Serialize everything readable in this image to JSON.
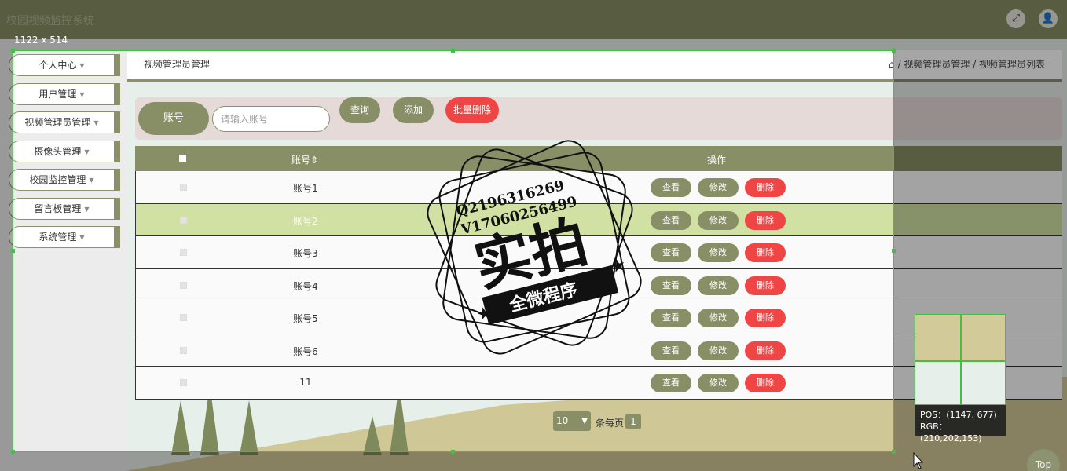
{
  "app": {
    "title": "校园视频监控系统"
  },
  "header": {
    "expand_icon": "⤢",
    "user_icon": "👤"
  },
  "sidebar": {
    "items": [
      {
        "label": "个人中心"
      },
      {
        "label": "用户管理"
      },
      {
        "label": "视频管理员管理"
      },
      {
        "label": "摄像头管理"
      },
      {
        "label": "校园监控管理"
      },
      {
        "label": "留言板管理"
      },
      {
        "label": "系统管理"
      }
    ]
  },
  "page": {
    "title": "视频管理员管理",
    "breadcrumb": "/ 视频管理员管理 / 视频管理员列表"
  },
  "search": {
    "label": "账号",
    "placeholder": "请输入账号",
    "query_label": "查询",
    "add_label": "添加",
    "batch_delete_label": "批量删除"
  },
  "table": {
    "headers": {
      "account": "账号",
      "sort_icon": "⇕",
      "ops": "操作"
    },
    "rows": [
      {
        "account": "账号1"
      },
      {
        "account": "账号2"
      },
      {
        "account": "账号3"
      },
      {
        "account": "账号4"
      },
      {
        "account": "账号5"
      },
      {
        "account": "账号6"
      },
      {
        "account": "11"
      }
    ],
    "actions": {
      "view": "查看",
      "edit": "修改",
      "delete": "删除"
    }
  },
  "pager": {
    "page_size": "10",
    "per_page_text": "条每页",
    "current_page": "1"
  },
  "capture_tool": {
    "size_label": "1122 x 514",
    "pos_label": "POS：(1147, 677)",
    "rgb_label": "RGB：(210,202,153)"
  },
  "watermark": {
    "line1": "Q2196316269",
    "line2": "V17060256499",
    "main": "实拍",
    "banner": "全微程序"
  },
  "top_button": {
    "label": "Top"
  },
  "colors": {
    "accent": "#888f66",
    "danger": "#f04545",
    "highlight_row": "#d1e0a3",
    "selection": "#3fc23f"
  }
}
